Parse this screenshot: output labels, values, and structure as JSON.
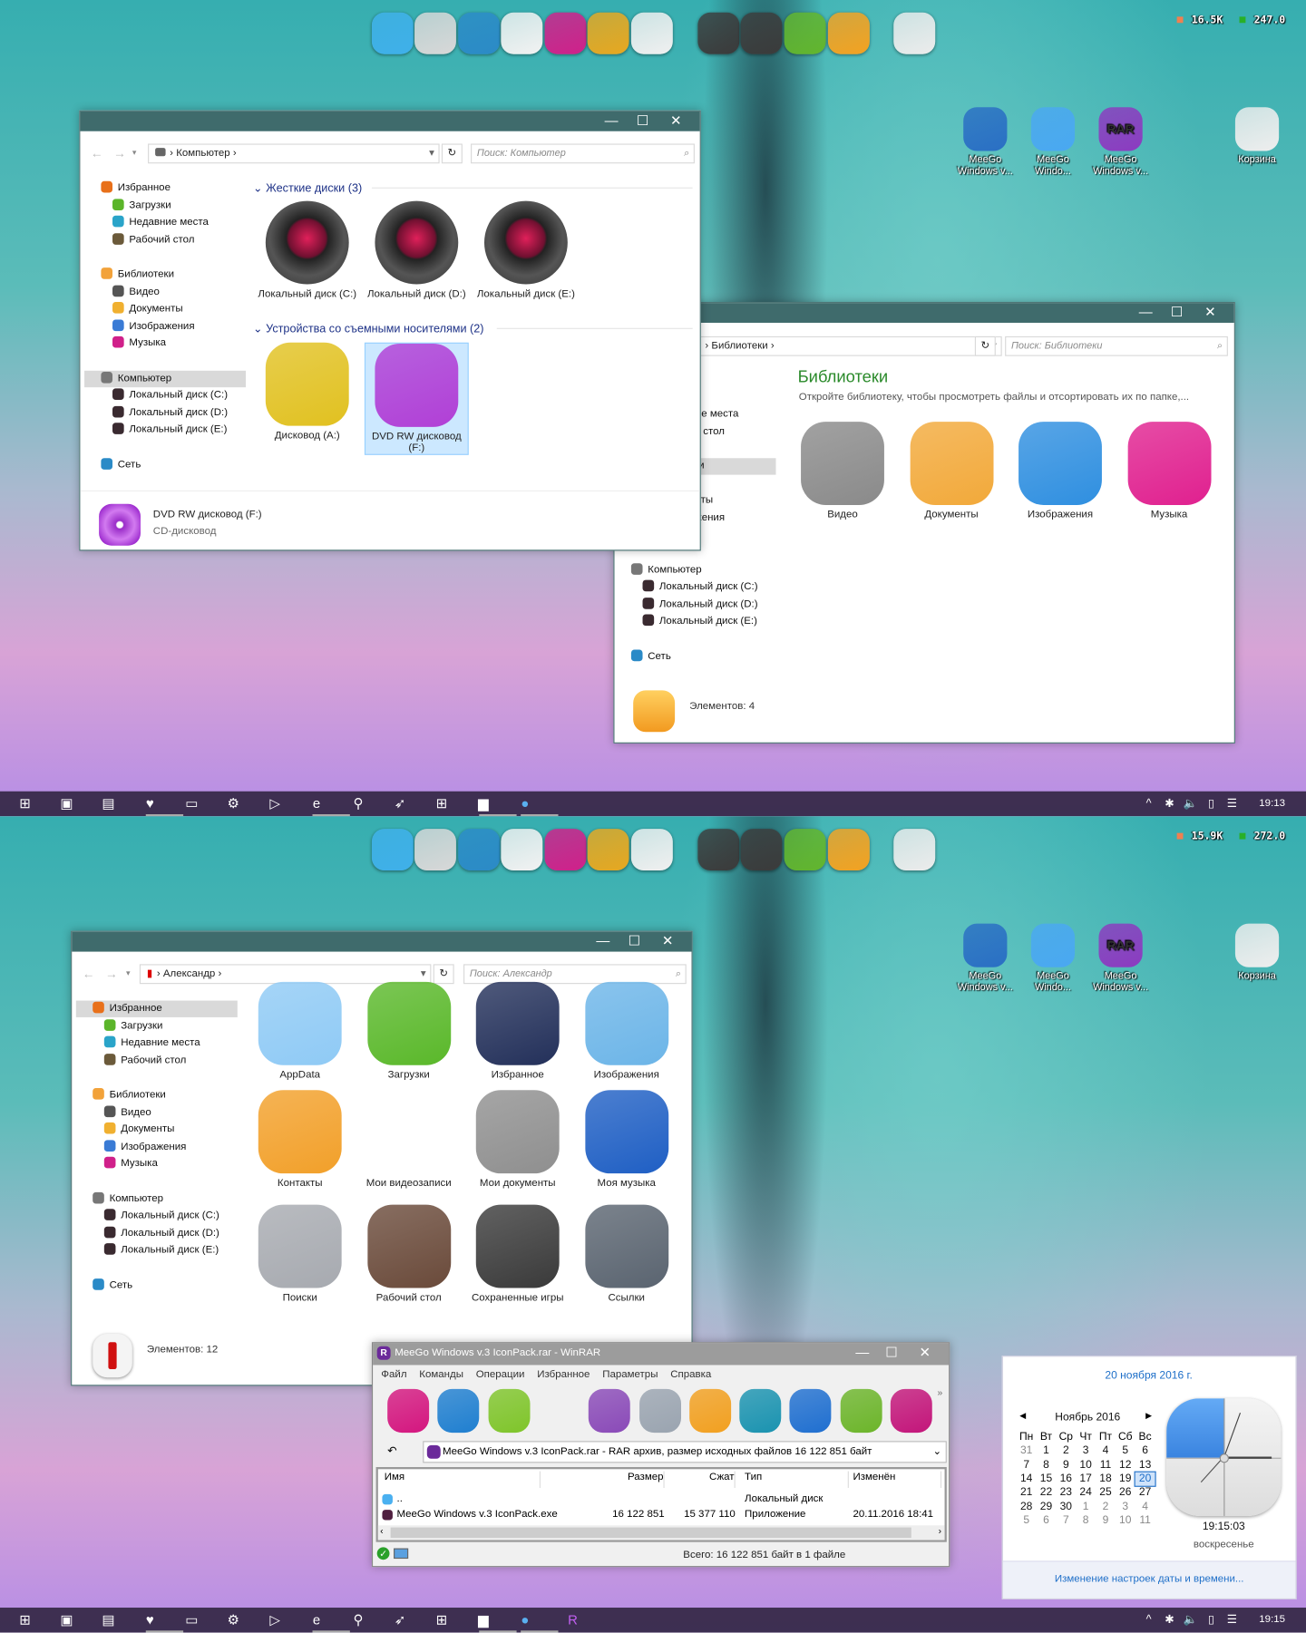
{
  "dock": [
    {
      "icon": "messenger-icon",
      "color": "#3fb0ea"
    },
    {
      "icon": "computer-icon",
      "color": "#d8d8d8"
    },
    {
      "icon": "globe-icon",
      "color": "#2b8ac7"
    },
    {
      "icon": "user-tie-icon",
      "color": "#f2f2f2"
    },
    {
      "icon": "gamepad-icon",
      "color": "#d0208a"
    },
    {
      "icon": "windows-logo-icon",
      "color": "#e7a820"
    },
    {
      "icon": "help-icon",
      "color": "#f0f0f0"
    },
    {
      "icon": "local-disk-icon",
      "color": "#3b3b3b"
    },
    {
      "icon": "system-disk-icon",
      "color": "#3b3b3b"
    },
    {
      "icon": "download-icon",
      "color": "#62b52d"
    },
    {
      "icon": "folder-icon",
      "color": "#f3a221"
    },
    {
      "icon": "recycle-bin-icon",
      "color": "#ececec"
    }
  ],
  "stats_top": {
    "up": "16.5K",
    "down": "247.0"
  },
  "stats_bottom": {
    "up": "15.9K",
    "down": "272.0"
  },
  "desktop_icons": [
    {
      "label": "MeeGo Windows v...",
      "icon": "windows-installer-icon",
      "color": "#2a6fc4"
    },
    {
      "label": "MeeGo Windo...",
      "icon": "folder-icon",
      "color": "#4aa8f2"
    },
    {
      "label": "MeeGo Windows v...",
      "icon": "winrar-icon",
      "color": "#8c3bc0",
      "text": "RAR"
    },
    {
      "label": "Корзина",
      "icon": "recycle-bin-icon",
      "color": "#eeeeee"
    }
  ],
  "computer_window": {
    "address": "Компьютер",
    "search_placeholder": "Поиск: Компьютер",
    "nav": [
      {
        "label": "Избранное",
        "color": "#e8701a"
      },
      {
        "label": "Загрузки",
        "color": "#5bb52a",
        "indent": true
      },
      {
        "label": "Недавние места",
        "color": "#2aa4c9",
        "indent": true
      },
      {
        "label": "Рабочий стол",
        "color": "#6b5a3a",
        "indent": true
      },
      {
        "label": "Библиотеки",
        "color": "#f2a23a",
        "gap": true
      },
      {
        "label": "Видео",
        "color": "#555",
        "indent": true
      },
      {
        "label": "Документы",
        "color": "#f0b030",
        "indent": true
      },
      {
        "label": "Изображения",
        "color": "#3a7bd5",
        "indent": true
      },
      {
        "label": "Музыка",
        "color": "#d0208a",
        "indent": true
      },
      {
        "label": "Компьютер",
        "color": "#777",
        "gap": true,
        "sel": true
      },
      {
        "label": "Локальный диск (C:)",
        "color": "#3a2a30",
        "indent": true
      },
      {
        "label": "Локальный диск (D:)",
        "color": "#3a2a30",
        "indent": true
      },
      {
        "label": "Локальный диск (E:)",
        "color": "#3a2a30",
        "indent": true
      },
      {
        "label": "Сеть",
        "color": "#2a8ac7",
        "gap": true
      }
    ],
    "group1": "Жесткие диски (3)",
    "drives": [
      "Локальный диск (C:)",
      "Локальный диск (D:)",
      "Локальный диск (E:)"
    ],
    "group2": "Устройства со съемными носителями (2)",
    "removable": [
      {
        "label": "Дисковод (A:)",
        "color": "#e1c120"
      },
      {
        "label": "DVD RW дисковод (F:)",
        "color": "#b13fd6"
      }
    ],
    "details": {
      "name": "DVD RW дисковод (F:)",
      "type": "CD-дисковод"
    }
  },
  "libraries_window": {
    "address": "Библиотеки",
    "search_placeholder": "Поиск: Библиотеки",
    "heading": "Библиотеки",
    "subtitle": "Откройте библиотеку, чтобы просмотреть файлы и отсортировать их по папке,...",
    "items": [
      {
        "label": "Видео",
        "color": "#8a8a8a"
      },
      {
        "label": "Документы",
        "color": "#f2a93a"
      },
      {
        "label": "Изображения",
        "color": "#2f8fe0"
      },
      {
        "label": "Музыка",
        "color": "#e0208f"
      }
    ],
    "status": "Элементов: 4"
  },
  "user_window": {
    "address": "Александр",
    "search_placeholder": "Поиск: Александр",
    "items": [
      {
        "label": "AppData",
        "color": "#8fcaf5"
      },
      {
        "label": "Загрузки",
        "color": "#5ab82a"
      },
      {
        "label": "Избранное",
        "color": "#23305a"
      },
      {
        "label": "Изображения",
        "color": "#6cb5e8"
      },
      {
        "label": "Контакты",
        "color": "#f2a02a"
      },
      {
        "label": "Мои видеозаписи",
        "color": "#333"
      },
      {
        "label": "Мои документы",
        "color": "#8f8f8f"
      },
      {
        "label": "Моя музыка",
        "color": "#1f5fc4"
      },
      {
        "label": "Поиски",
        "color": "#a7aab0"
      },
      {
        "label": "Рабочий стол",
        "color": "#6a4a3a"
      },
      {
        "label": "Сохраненные игры",
        "color": "#3a3a3a"
      },
      {
        "label": "Ссылки",
        "color": "#5a6470"
      }
    ],
    "status": "Элементов: 12"
  },
  "winrar": {
    "title": "MeeGo Windows v.3 IconPack.rar - WinRAR",
    "menu": [
      "Файл",
      "Команды",
      "Операции",
      "Избранное",
      "Параметры",
      "Справка"
    ],
    "toolbar": [
      {
        "icon": "add-icon",
        "color": "#d4167f"
      },
      {
        "icon": "extract-icon",
        "color": "#1f7fd0"
      },
      {
        "icon": "test-icon",
        "color": "#7fc52a"
      },
      {
        "icon": "view-icon",
        "color": "#777"
      },
      {
        "icon": "delete-icon",
        "color": "#8a4ab8"
      },
      {
        "icon": "find-icon",
        "color": "#9aa4b0"
      },
      {
        "icon": "wizard-icon",
        "color": "#f2a020"
      },
      {
        "icon": "info-user-icon",
        "color": "#1a93b0"
      },
      {
        "icon": "repair-icon",
        "color": "#1f6fd0"
      },
      {
        "icon": "info-icon",
        "color": "#6cb52a"
      },
      {
        "icon": "power-icon",
        "color": "#c3157a"
      }
    ],
    "path": "MeeGo Windows v.3 IconPack.rar - RAR архив, размер исходных файлов 16 122 851 байт",
    "columns": [
      "Имя",
      "Размер",
      "Сжат",
      "Тип",
      "Изменён"
    ],
    "rows": [
      {
        "name": "..",
        "size": "",
        "packed": "",
        "type": "Локальный диск",
        "modified": ""
      },
      {
        "name": "MeeGo Windows v.3 IconPack.exe",
        "size": "16 122 851",
        "packed": "15 377 110",
        "type": "Приложение",
        "modified": "20.11.2016 18:41"
      }
    ],
    "status": "Всего: 16 122 851 байт в 1 файле"
  },
  "calendar": {
    "date_title": "20 ноября 2016 г.",
    "month": "Ноябрь 2016",
    "weekdays": [
      "Пн",
      "Вт",
      "Ср",
      "Чт",
      "Пт",
      "Сб",
      "Вс"
    ],
    "weeks": [
      [
        "31",
        "1",
        "2",
        "3",
        "4",
        "5",
        "6"
      ],
      [
        "7",
        "8",
        "9",
        "10",
        "11",
        "12",
        "13"
      ],
      [
        "14",
        "15",
        "16",
        "17",
        "18",
        "19",
        "20"
      ],
      [
        "21",
        "22",
        "23",
        "24",
        "25",
        "26",
        "27"
      ],
      [
        "28",
        "29",
        "30",
        "1",
        "2",
        "3",
        "4"
      ],
      [
        "5",
        "6",
        "7",
        "8",
        "9",
        "10",
        "11"
      ]
    ],
    "selected": "20",
    "time": "19:15:03",
    "weekday": "воскресенье",
    "settings_link": "Изменение настроек даты и времени..."
  },
  "taskbar": {
    "time_top": "19:13",
    "time_bottom": "19:15"
  }
}
